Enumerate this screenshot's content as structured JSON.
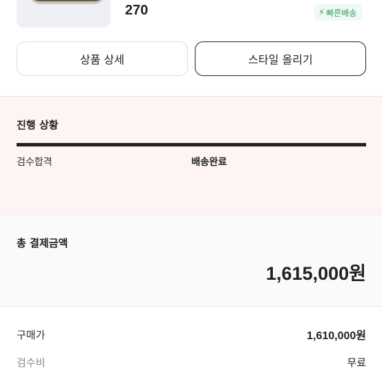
{
  "product": {
    "size": "270",
    "badge_label": "빠른배송",
    "badge_icon": "lightning-icon"
  },
  "actions": {
    "detail_label": "상품 상세",
    "style_label": "스타일 올리기"
  },
  "progress": {
    "title": "진행 상황",
    "steps": [
      "검수합격",
      "배송완료"
    ],
    "fill_fraction": 1.0
  },
  "total": {
    "label": "총 결제금액",
    "amount": "1,615,000원"
  },
  "breakdown": [
    {
      "label": "구매가",
      "value": "1,610,000원"
    },
    {
      "label": "검수비",
      "value": "무료"
    }
  ],
  "colors": {
    "badge_green": "#2aa05b",
    "progress_bg": "#fdf4f3"
  }
}
